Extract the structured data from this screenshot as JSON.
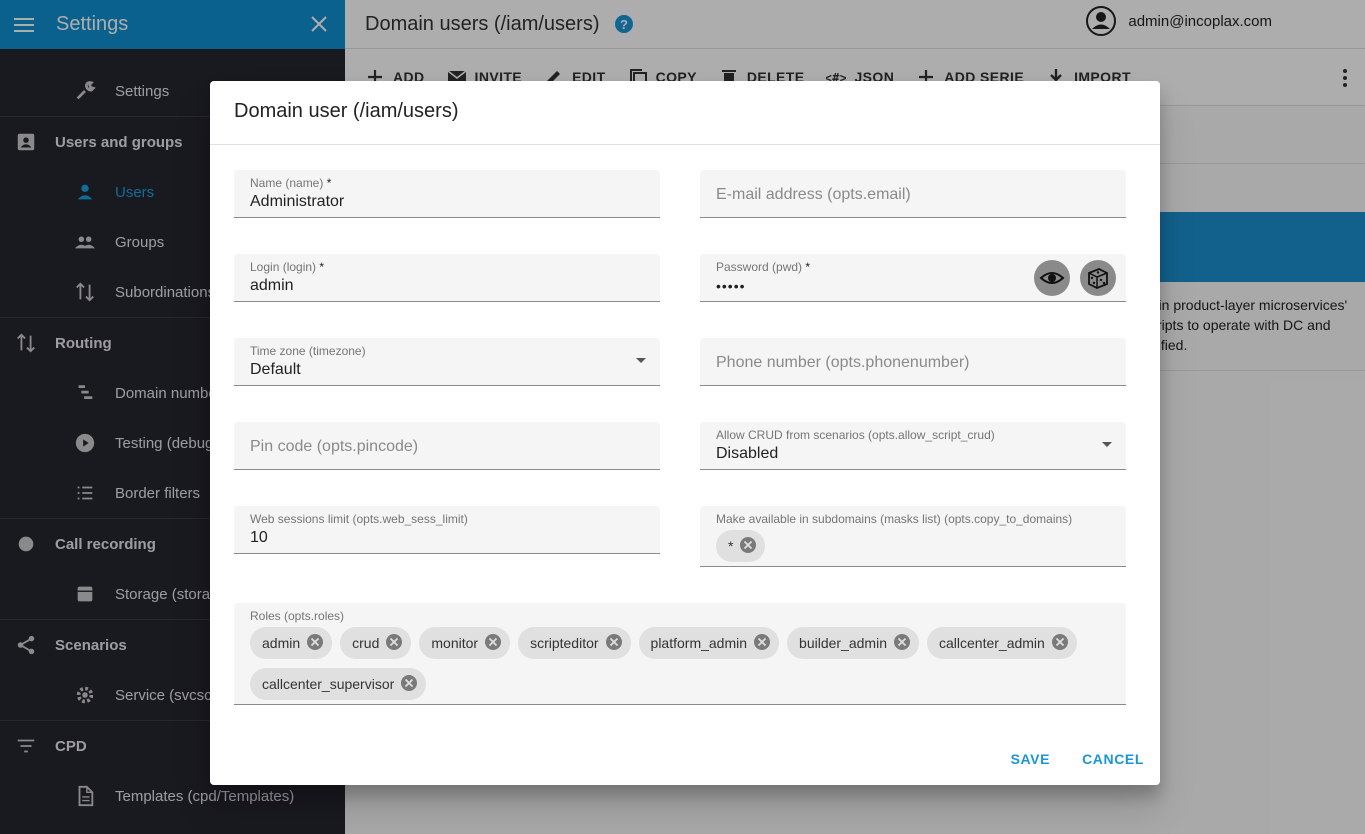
{
  "sidebar": {
    "title": "Settings",
    "items": [
      {
        "type": "child",
        "icon": "wrench-icon",
        "label": "Settings",
        "name": "sidebar-item-settings"
      },
      {
        "type": "group",
        "icon": "contacts-icon",
        "label": "Users and groups",
        "name": "sidebar-group-users-and-groups"
      },
      {
        "type": "child",
        "icon": "person-icon",
        "label": "Users",
        "name": "sidebar-item-users",
        "active": true
      },
      {
        "type": "child",
        "icon": "people-icon",
        "label": "Groups",
        "name": "sidebar-item-groups"
      },
      {
        "type": "child",
        "icon": "swap-vert-icon",
        "label": "Subordinations",
        "name": "sidebar-item-subordinations"
      },
      {
        "type": "group",
        "icon": "swap-vert-icon",
        "label": "Routing",
        "name": "sidebar-group-routing"
      },
      {
        "type": "child",
        "icon": "list-steps-icon",
        "label": "Domain numbers",
        "name": "sidebar-item-domain-numbers"
      },
      {
        "type": "child",
        "icon": "play-circle-icon",
        "label": "Testing (debug)",
        "name": "sidebar-item-testing"
      },
      {
        "type": "child",
        "icon": "list-icon",
        "label": "Border filters",
        "name": "sidebar-item-border-filters"
      },
      {
        "type": "group",
        "icon": "circle-icon",
        "label": "Call recording",
        "name": "sidebar-group-call-recording"
      },
      {
        "type": "child",
        "icon": "storage-icon",
        "label": "Storage (storages)",
        "name": "sidebar-item-storage"
      },
      {
        "type": "group",
        "icon": "share-icon",
        "label": "Scenarios",
        "name": "sidebar-group-scenarios"
      },
      {
        "type": "child",
        "icon": "gear-icon",
        "label": "Service (svcscripts)",
        "name": "sidebar-item-service"
      },
      {
        "type": "group",
        "icon": "filter-icon",
        "label": "CPD",
        "name": "sidebar-group-cpd"
      },
      {
        "type": "child",
        "icon": "document-icon",
        "label": "Templates (cpd/Templates)",
        "name": "sidebar-item-templates"
      }
    ]
  },
  "header": {
    "page_title": "Domain users (/iam/users)",
    "user_email": "admin@incoplax.com"
  },
  "toolbar": {
    "buttons": [
      {
        "label": "ADD",
        "icon": "plus-icon"
      },
      {
        "label": "INVITE",
        "icon": "mail-icon"
      },
      {
        "label": "EDIT",
        "icon": "pencil-icon"
      },
      {
        "label": "COPY",
        "icon": "copy-icon"
      },
      {
        "label": "DELETE",
        "icon": "trash-icon"
      },
      {
        "label": "JSON",
        "icon": "code-icon"
      },
      {
        "label": "ADD SERIE",
        "icon": "plus-icon"
      },
      {
        "label": "IMPORT",
        "icon": "download-icon"
      }
    ]
  },
  "background_text": {
    "line1": ") in product-layer microservices'",
    "line2": "cripts to operate with DC and",
    "line3": "dified."
  },
  "dialog": {
    "title": "Domain user (/iam/users)",
    "name": {
      "label": "Name (name)",
      "required": "*",
      "value": "Administrator"
    },
    "email": {
      "placeholder": "E-mail address (opts.email)"
    },
    "login": {
      "label": "Login (login)",
      "required": "*",
      "value": "admin"
    },
    "password": {
      "label": "Password (pwd)",
      "required": "*",
      "value": "•••••"
    },
    "timezone": {
      "label": "Time zone (timezone)",
      "value": "Default"
    },
    "phone": {
      "placeholder": "Phone number (opts.phonenumber)"
    },
    "pincode": {
      "placeholder": "Pin code (opts.pincode)"
    },
    "allow_crud": {
      "label": "Allow CRUD from scenarios (opts.allow_script_crud)",
      "value": "Disabled"
    },
    "web_sess": {
      "label": "Web sessions limit (opts.web_sess_limit)",
      "value": "10"
    },
    "copy_domains": {
      "label": "Make available in subdomains (masks list) (opts.copy_to_domains)",
      "chips": [
        "*"
      ]
    },
    "roles": {
      "label": "Roles (opts.roles)",
      "chips": [
        "admin",
        "crud",
        "monitor",
        "scripteditor",
        "platform_admin",
        "builder_admin",
        "callcenter_admin",
        "callcenter_supervisor"
      ]
    },
    "save_label": "SAVE",
    "cancel_label": "CANCEL"
  },
  "colors": {
    "accent": "#1a96d8",
    "sidebar_bg": "#262630",
    "header_bg": "#1090d0"
  }
}
